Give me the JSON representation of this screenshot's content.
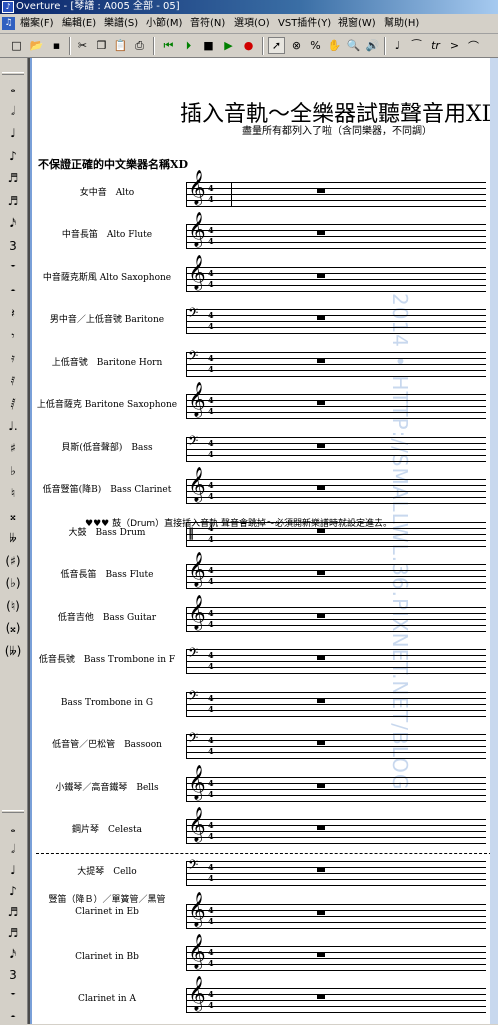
{
  "window": {
    "title": "Overture - [琴譜 : A005 全部 - 05]"
  },
  "menu": {
    "items": [
      "檔案(F)",
      "編輯(E)",
      "樂譜(S)",
      "小節(M)",
      "音符(N)",
      "選項(O)",
      "VST插件(Y)",
      "視窗(W)",
      "幫助(H)"
    ]
  },
  "toolbar": {
    "buttons": [
      {
        "name": "new-icon",
        "glyph": "□"
      },
      {
        "name": "open-icon",
        "glyph": "📂"
      },
      {
        "name": "save-icon",
        "glyph": "▪"
      },
      {
        "name": "cut-icon",
        "glyph": "✂"
      },
      {
        "name": "copy-icon",
        "glyph": "❐"
      },
      {
        "name": "paste-icon",
        "glyph": "📋"
      },
      {
        "name": "print-icon",
        "glyph": "⎙"
      },
      {
        "name": "rewind-start-icon",
        "glyph": "⏮"
      },
      {
        "name": "play-from-icon",
        "glyph": "⏵"
      },
      {
        "name": "stop-icon",
        "glyph": "■"
      },
      {
        "name": "play-icon",
        "glyph": "▶"
      },
      {
        "name": "record-icon",
        "glyph": "●"
      },
      {
        "name": "arrow-pointer-icon",
        "glyph": "➚"
      },
      {
        "name": "eraser-icon",
        "glyph": "⊗"
      },
      {
        "name": "percent-icon",
        "glyph": "%"
      },
      {
        "name": "hand-icon",
        "glyph": "✋"
      },
      {
        "name": "zoom-icon",
        "glyph": "🔍"
      },
      {
        "name": "speaker-icon",
        "glyph": "🔊"
      },
      {
        "name": "quarter-note-icon",
        "glyph": "♩"
      },
      {
        "name": "tie-note-icon",
        "glyph": "⁀"
      },
      {
        "name": "trill-icon",
        "glyph": "tr"
      },
      {
        "name": "accent-icon",
        "glyph": ">"
      },
      {
        "name": "slur-icon",
        "glyph": "⌒"
      }
    ]
  },
  "palette": {
    "items": [
      "𝅝",
      "𝅗𝅥",
      "♩",
      "♪",
      "♬",
      "♬",
      "𝅘𝅥𝅯",
      "3",
      "𝄻",
      "𝄼",
      "𝄽",
      "𝄾",
      "𝄿",
      "𝅀",
      "𝅁",
      "♩.",
      "♯",
      "♭",
      "♮",
      "𝄪",
      "𝄫",
      "(♯)",
      "(♭)",
      "(♮)",
      "(𝄪)",
      "(𝄫)"
    ],
    "items_lower": [
      "𝅝",
      "𝅗𝅥",
      "♩",
      "♪",
      "♬",
      "♬",
      "𝅘𝅥𝅯",
      "3",
      "𝄻",
      "𝄼"
    ]
  },
  "score": {
    "title": "插入音軌～全樂器試聽聲音用XD",
    "subtitle": "盡量所有都列入了啦（含同樂器，不同調）",
    "section_heading": "不保證正確的中文樂器名稱XD",
    "drum_note": "♥♥♥ 鼓（Drum）直接插入音軌 聲音會跳掉～必須開新樂譜時就設定進去。",
    "watermark": "2014 • HTTP://SMALLWL.36.PIXNET.NET/BLOG",
    "time_signature": {
      "top": "4",
      "bottom": "4"
    },
    "instruments": [
      {
        "label": "女中音　Alto",
        "clef": "treble"
      },
      {
        "label": "中音長笛　Alto Flute",
        "clef": "treble"
      },
      {
        "label": "中音薩克斯風 Alto Saxophone",
        "clef": "treble"
      },
      {
        "label": "男中音／上低音號 Baritone",
        "clef": "bass"
      },
      {
        "label": "上低音號　Baritone Horn",
        "clef": "bass"
      },
      {
        "label": "上低音薩克 Baritone Saxophone",
        "clef": "treble"
      },
      {
        "label": "貝斯(低音聲部)　Bass",
        "clef": "bass"
      },
      {
        "label": "低音豎笛(降B)　Bass Clarinet",
        "clef": "treble"
      },
      {
        "label": "大鼓　Bass Drum",
        "clef": "perc"
      },
      {
        "label": "低音長笛　Bass Flute",
        "clef": "treble"
      },
      {
        "label": "低音吉他　Bass Guitar",
        "clef": "treble"
      },
      {
        "label": "低音長號　Bass Trombone in F",
        "clef": "bass"
      },
      {
        "label": "Bass Trombone in G",
        "clef": "bass"
      },
      {
        "label": "低音管／巴松管　Bassoon",
        "clef": "bass"
      },
      {
        "label": "小鐵琴／高音鐵琴　Bells",
        "clef": "treble"
      },
      {
        "label": "鋼片琴　Celesta",
        "clef": "treble"
      },
      {
        "label": "大提琴　Cello",
        "clef": "bass"
      },
      {
        "label": "豎笛（降Ｂ）／單簧管／黑管 Clarinet in Eb",
        "clef": "treble"
      },
      {
        "label": "Clarinet in Bb",
        "clef": "treble"
      },
      {
        "label": "Clarinet in A",
        "clef": "treble"
      }
    ]
  }
}
